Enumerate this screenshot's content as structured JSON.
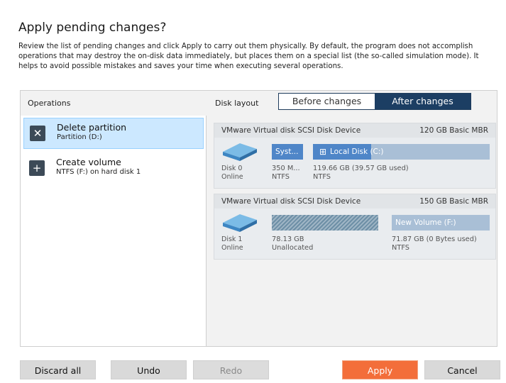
{
  "dialog": {
    "title": "Apply pending changes?",
    "description": "Review the list of pending changes and click Apply to carry out them physically. By default, the program does not accomplish operations that may destroy the on-disk data immediately, but places them on a special list (the so-called simulation mode). It helps to avoid possible mistakes and saves your time when executing several operations."
  },
  "operations": {
    "header": "Operations",
    "items": [
      {
        "name": "Delete partition",
        "sub": "Partition (D:)",
        "icon": "close-icon",
        "glyph": "✕"
      },
      {
        "name": "Create volume",
        "sub": "NTFS (F:) on hard disk 1",
        "icon": "plus-icon",
        "glyph": "+"
      }
    ]
  },
  "layout": {
    "label": "Disk layout",
    "toggle": {
      "before": "Before changes",
      "after": "After changes",
      "selected": "after"
    }
  },
  "disks": [
    {
      "device": "VMware Virtual disk SCSI Disk Device",
      "size": "120 GB Basic MBR",
      "name": "Disk 0",
      "status": "Online",
      "partitions": [
        {
          "label": "Syst...",
          "size": "350 M...",
          "fs": "NTFS"
        },
        {
          "label": "Local Disk (C:)",
          "size": "119.66 GB (39.57 GB used)",
          "fs": "NTFS",
          "used_fraction": 0.33
        }
      ]
    },
    {
      "device": "VMware Virtual disk SCSI Disk Device",
      "size": "150 GB Basic MBR",
      "name": "Disk 1",
      "status": "Online",
      "partitions": [
        {
          "label": "",
          "size": "78.13 GB",
          "fs": "Unallocated"
        },
        {
          "label": "New Volume (F:)",
          "size": "71.87 GB (0 Bytes used)",
          "fs": "NTFS",
          "used_fraction": 0
        }
      ]
    }
  ],
  "buttons": {
    "discard_all": "Discard all",
    "undo": "Undo",
    "redo": "Redo",
    "apply": "Apply",
    "cancel": "Cancel"
  },
  "colors": {
    "accent_navy": "#1c3e63",
    "apply_orange": "#f36e3a",
    "selected_blue": "#cce8ff",
    "partition_blue": "#4f86c8",
    "partition_light": "#a9bfd6"
  }
}
